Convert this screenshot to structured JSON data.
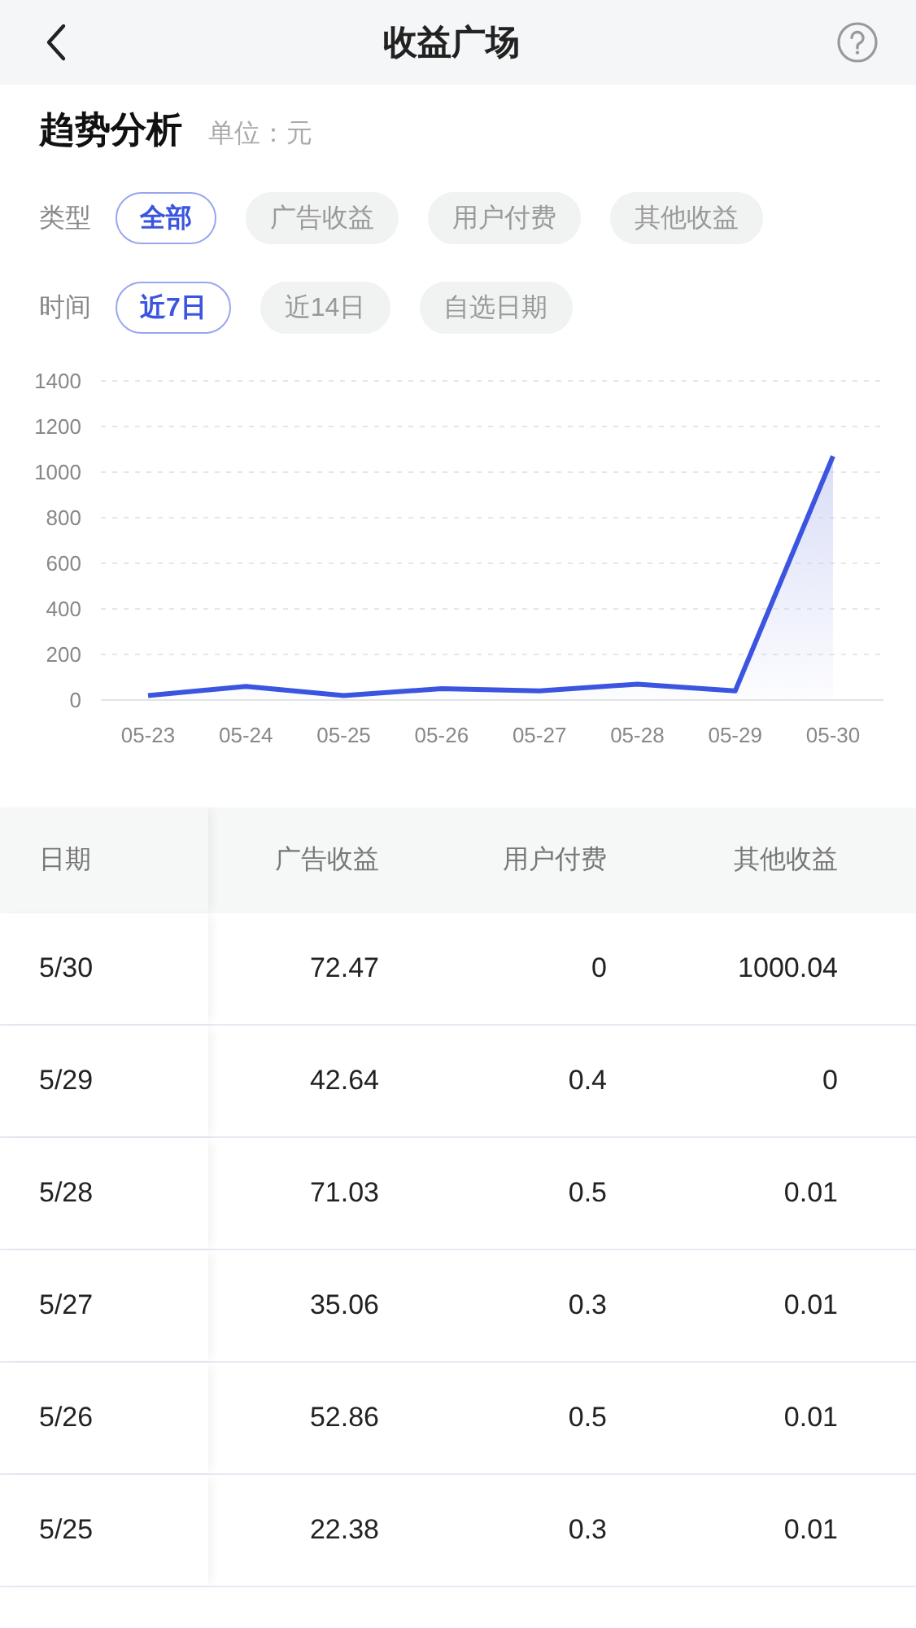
{
  "nav": {
    "title": "收益广场"
  },
  "section": {
    "title": "趋势分析",
    "unit": "单位：元"
  },
  "filters": [
    {
      "label": "类型",
      "options": [
        {
          "label": "全部",
          "selected": true
        },
        {
          "label": "广告收益",
          "selected": false
        },
        {
          "label": "用户付费",
          "selected": false
        },
        {
          "label": "其他收益",
          "selected": false
        }
      ]
    },
    {
      "label": "时间",
      "options": [
        {
          "label": "近7日",
          "selected": true
        },
        {
          "label": "近14日",
          "selected": false
        },
        {
          "label": "自选日期",
          "selected": false
        }
      ]
    }
  ],
  "chart_data": {
    "type": "area",
    "categories": [
      "05-23",
      "05-24",
      "05-25",
      "05-26",
      "05-27",
      "05-28",
      "05-29",
      "05-30"
    ],
    "series": [
      {
        "color": "#3b55e0",
        "values": [
          20,
          60,
          20,
          50,
          40,
          70,
          40,
          1070
        ]
      }
    ],
    "ylim": [
      0,
      1400
    ],
    "yticks": [
      0,
      200,
      400,
      600,
      800,
      1000,
      1200,
      1400
    ],
    "grid": true
  },
  "table": {
    "columns": [
      "日期",
      "广告收益",
      "用户付费",
      "其他收益"
    ],
    "rows": [
      [
        "5/30",
        "72.47",
        "0",
        "1000.04"
      ],
      [
        "5/29",
        "42.64",
        "0.4",
        "0"
      ],
      [
        "5/28",
        "71.03",
        "0.5",
        "0.01"
      ],
      [
        "5/27",
        "35.06",
        "0.3",
        "0.01"
      ],
      [
        "5/26",
        "52.86",
        "0.5",
        "0.01"
      ],
      [
        "5/25",
        "22.38",
        "0.3",
        "0.01"
      ]
    ]
  }
}
